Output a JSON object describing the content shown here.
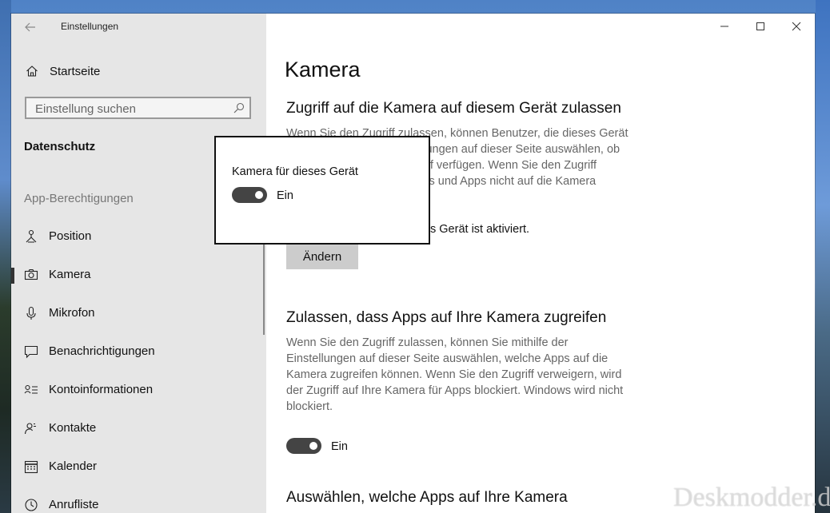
{
  "window": {
    "app_title": "Einstellungen",
    "back_icon": "arrow-left-icon",
    "controls": {
      "minimize_icon": "minimize-icon",
      "maximize_icon": "maximize-icon",
      "close_icon": "close-icon"
    }
  },
  "sidebar": {
    "home_label": "Startseite",
    "search_placeholder": "Einstellung suchen",
    "section_title": "Datenschutz",
    "group_title": "App-Berechtigungen",
    "items": [
      {
        "label": "Position",
        "icon": "location-icon",
        "active": false
      },
      {
        "label": "Kamera",
        "icon": "camera-icon",
        "active": true
      },
      {
        "label": "Mikrofon",
        "icon": "microphone-icon",
        "active": false
      },
      {
        "label": "Benachrichtigungen",
        "icon": "notification-icon",
        "active": false
      },
      {
        "label": "Kontoinformationen",
        "icon": "account-info-icon",
        "active": false
      },
      {
        "label": "Kontakte",
        "icon": "contacts-icon",
        "active": false
      },
      {
        "label": "Kalender",
        "icon": "calendar-icon",
        "active": false
      },
      {
        "label": "Anrufliste",
        "icon": "call-history-icon",
        "active": false
      }
    ]
  },
  "main": {
    "page_title": "Kamera",
    "section1": {
      "heading": "Zugriff auf die Kamera auf diesem Gerät zulassen",
      "lines": [
        "Wenn Sie den Zugriff zulassen, können Benutzer, die dieses Gerät",
        "llungen auf dieser Seite auswählen, ob",
        "riff verfügen. Wenn Sie den Zugriff",
        "ws und Apps nicht auf die Kamera"
      ],
      "status": "s Gerät ist aktiviert.",
      "button": "Ändern"
    },
    "section2": {
      "heading": "Zulassen, dass Apps auf Ihre Kamera zugreifen",
      "lines": [
        "Wenn Sie den Zugriff zulassen, können Sie mithilfe der",
        "Einstellungen auf dieser Seite auswählen, welche Apps auf die",
        "Kamera zugreifen können. Wenn Sie den Zugriff verweigern, wird",
        "der Zugriff auf Ihre Kamera für Apps blockiert. Windows wird nicht",
        "blockiert."
      ],
      "toggle_label": "Ein",
      "toggle_on": true
    },
    "section3": {
      "heading": "Auswählen, welche Apps auf Ihre Kamera"
    }
  },
  "popup": {
    "title": "Kamera für dieses Gerät",
    "toggle_label": "Ein",
    "toggle_on": true
  },
  "watermark": "Deskmodder.de"
}
